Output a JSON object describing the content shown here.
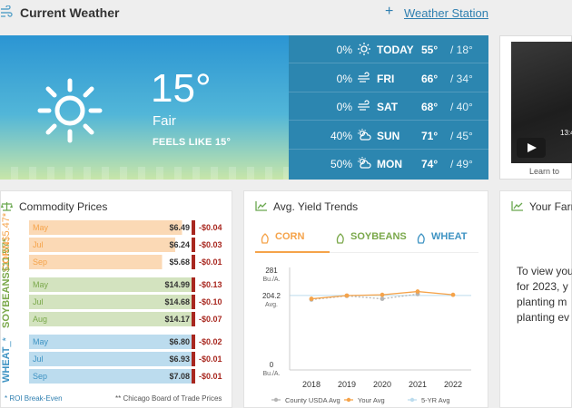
{
  "header": {
    "title": "Current Weather",
    "station_plus": "+",
    "station_link": "Weather Station",
    "title_icon": "wind-icon"
  },
  "weather": {
    "temperature": "15°",
    "condition": "Fair",
    "feels_like": "FEELS LIKE 15°",
    "icon": "sun-icon",
    "forecast": [
      {
        "precip": "0%",
        "icon": "sun-icon",
        "day": "TODAY",
        "high": "55°",
        "low": "/ 18°"
      },
      {
        "precip": "0%",
        "icon": "windy-icon",
        "day": "FRI",
        "high": "66°",
        "low": "/ 34°"
      },
      {
        "precip": "0%",
        "icon": "windy-icon",
        "day": "SAT",
        "high": "68°",
        "low": "/ 40°"
      },
      {
        "precip": "40%",
        "icon": "partly-sunny-icon",
        "day": "SUN",
        "high": "71°",
        "low": "/ 45°"
      },
      {
        "precip": "50%",
        "icon": "partly-sunny-icon",
        "day": "MON",
        "high": "74°",
        "low": "/ 49°"
      }
    ]
  },
  "video": {
    "time": "13:4",
    "caption": "Learn to"
  },
  "commodity": {
    "title": "Commodity Prices",
    "groups": [
      {
        "name": "CORN",
        "breakeven": "$5.47*",
        "color": "#f5a34a",
        "row_bg": "#fbd9b5",
        "rows": [
          {
            "month": "May",
            "price": "$6.49",
            "change": "-$0.04",
            "pct": 0.92
          },
          {
            "month": "Jul",
            "price": "$6.24",
            "change": "-$0.03",
            "pct": 0.88
          },
          {
            "month": "Sep",
            "price": "$5.68",
            "change": "-$0.01",
            "pct": 0.8
          }
        ]
      },
      {
        "name": "SOYBEANS",
        "breakeven": "$11.57*",
        "color": "#7aa84a",
        "row_bg": "#d3e3bf",
        "rows": [
          {
            "month": "May",
            "price": "$14.99",
            "change": "-$0.13",
            "pct": 1.0
          },
          {
            "month": "Jul",
            "price": "$14.68",
            "change": "-$0.10",
            "pct": 1.0
          },
          {
            "month": "Aug",
            "price": "$14.17",
            "change": "-$0.07",
            "pct": 1.0
          }
        ]
      },
      {
        "name": "WHEAT",
        "breakeven": "_*",
        "color": "#3e93c3",
        "row_bg": "#bcdcee",
        "rows": [
          {
            "month": "May",
            "price": "$6.80",
            "change": "-$0.02",
            "pct": 1.0
          },
          {
            "month": "Jul",
            "price": "$6.93",
            "change": "-$0.01",
            "pct": 1.0
          },
          {
            "month": "Sep",
            "price": "$7.08",
            "change": "-$0.01",
            "pct": 1.0
          }
        ]
      }
    ],
    "footnote_left": "* ROI Break-Even",
    "footnote_right": "** Chicago Board of Trade Prices"
  },
  "yield": {
    "title": "Avg. Yield Trends",
    "tabs": [
      {
        "label": "CORN",
        "icon": "corn-icon",
        "color": "#f5a34a",
        "active": true
      },
      {
        "label": "SOYBEANS",
        "icon": "soybean-icon",
        "color": "#7aa84a",
        "active": false
      },
      {
        "label": "WHEAT",
        "icon": "wheat-icon",
        "color": "#3e93c3",
        "active": false
      }
    ]
  },
  "chart_data": {
    "type": "line",
    "x": [
      "2018",
      "2019",
      "2020",
      "2021",
      "2022"
    ],
    "ylim": [
      0,
      281
    ],
    "yticks": [
      {
        "value": 281,
        "label": "281",
        "sub": "Bu./A."
      },
      {
        "value": 204.2,
        "label": "204.2",
        "sub": "Avg."
      },
      {
        "value": 0,
        "label": "0",
        "sub": "Bu./A."
      }
    ],
    "series": [
      {
        "name": "County USDA Avg",
        "color": "#b5b5b5",
        "dashed": true,
        "values": [
          193,
          203,
          195,
          208,
          null
        ]
      },
      {
        "name": "Your Avg",
        "color": "#f5a34a",
        "dashed": false,
        "values": [
          195,
          204,
          206,
          215,
          206
        ]
      },
      {
        "name": "5-YR Avg",
        "color": "#bcdcee",
        "dashed": false,
        "values": [
          204.2,
          204.2,
          204.2,
          204.2,
          204.2
        ]
      }
    ]
  },
  "farm": {
    "title": "Your Farm",
    "message": [
      "To view you",
      "for 2023, y",
      "planting m",
      "planting ev"
    ]
  }
}
